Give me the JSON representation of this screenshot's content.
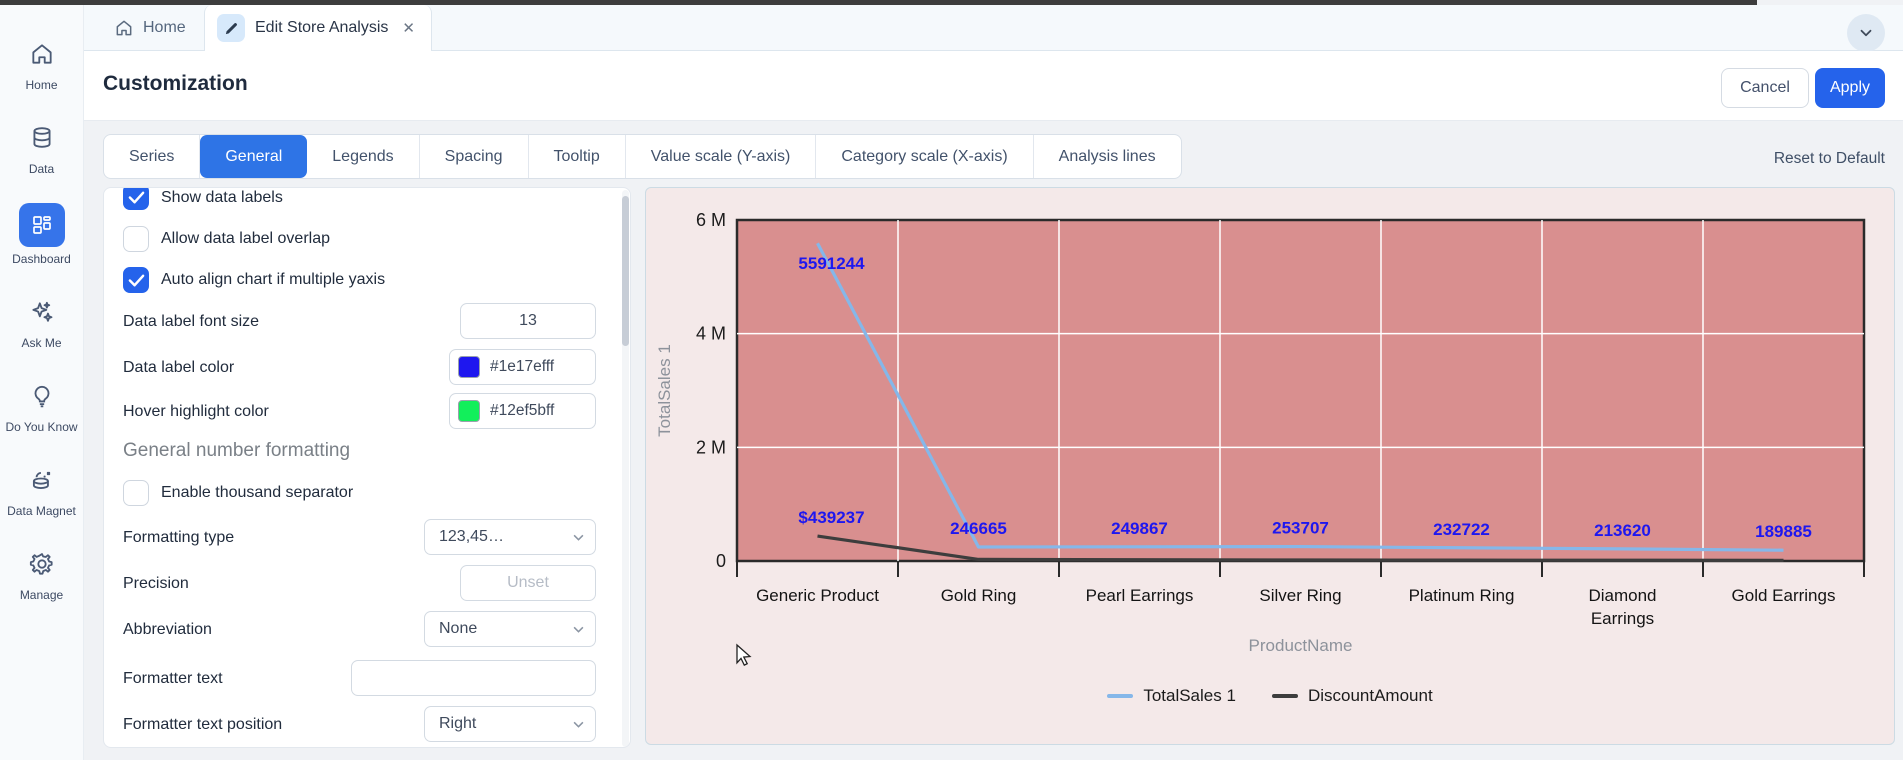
{
  "colors": {
    "accent_blue": "#2e74e6",
    "apply_blue": "#2563eb",
    "data_label_blue": "#1e17ef",
    "swatch_blue": "#1e17ef",
    "swatch_green": "#12ef5b",
    "plot_bg": "#d98f8f",
    "chart_panel_bg": "#f4e9e9",
    "series_blue": "#85b7e9",
    "series_dark": "#3d3d3d"
  },
  "doc_strip": {
    "home_label": "Home",
    "doc_tab_label": "Edit Store Analysis",
    "close_glyph": "✕"
  },
  "sidebar": {
    "items": [
      {
        "label": "Home",
        "icon": "home-icon",
        "active": false
      },
      {
        "label": "Data",
        "icon": "database-icon",
        "active": false
      },
      {
        "label": "Dashboard",
        "icon": "dashboard-icon",
        "active": true
      },
      {
        "label": "Ask Me",
        "icon": "sparkles-icon",
        "active": false
      },
      {
        "label": "Do You Know",
        "icon": "lightbulb-icon",
        "active": false
      },
      {
        "label": "Data Magnet",
        "icon": "data-magnet-icon",
        "active": false
      },
      {
        "label": "Manage",
        "icon": "gear-icon",
        "active": false
      }
    ]
  },
  "header": {
    "title": "Customization",
    "cancel_label": "Cancel",
    "apply_label": "Apply"
  },
  "tab_strip": {
    "tabs": [
      "Series",
      "General",
      "Legends",
      "Spacing",
      "Tooltip",
      "Value scale (Y-axis)",
      "Category scale (X-axis)",
      "Analysis lines"
    ],
    "active_tab": "General",
    "reset_label": "Reset to Default"
  },
  "form": {
    "show_data_labels": {
      "label": "Show data labels",
      "checked": true
    },
    "allow_overlap": {
      "label": "Allow data label overlap",
      "checked": false
    },
    "auto_align": {
      "label": "Auto align chart if multiple yaxis",
      "checked": true
    },
    "font_size": {
      "label": "Data label font size",
      "value": "13"
    },
    "label_color": {
      "label": "Data label color",
      "value": "#1e17efff",
      "swatch": "#1e17ef"
    },
    "hover_color": {
      "label": "Hover highlight color",
      "value": "#12ef5bff",
      "swatch": "#12ef5b"
    },
    "section_heading": "General number formatting",
    "thousand_separator": {
      "label": "Enable thousand separator",
      "checked": false
    },
    "formatting_type": {
      "label": "Formatting type",
      "value": "123,45…"
    },
    "precision": {
      "label": "Precision",
      "placeholder": "Unset"
    },
    "abbreviation": {
      "label": "Abbreviation",
      "value": "None"
    },
    "formatter_text": {
      "label": "Formatter text",
      "value": ""
    },
    "formatter_text_position": {
      "label": "Formatter text position",
      "value": "Right"
    }
  },
  "chart_data": {
    "type": "line",
    "xlabel": "ProductName",
    "ylabel": "TotalSales 1",
    "categories": [
      "Generic Product",
      "Gold Ring",
      "Pearl Earrings",
      "Silver Ring",
      "Platinum Ring",
      "Diamond Earrings",
      "Gold Earrings"
    ],
    "series": [
      {
        "name": "TotalSales 1",
        "color": "#85b7e9",
        "values": [
          5591244,
          246665,
          249867,
          253707,
          232722,
          213620,
          189885
        ],
        "labels": [
          "5591244",
          "246665",
          "249867",
          "253707",
          "232722",
          "213620",
          "189885"
        ]
      },
      {
        "name": "DiscountAmount",
        "color": "#3d3d3d",
        "values": [
          439237,
          28000,
          22000,
          18000,
          15000,
          13000,
          11000
        ],
        "labels": [
          "$439237",
          "",
          "",
          "",
          "",
          "",
          ""
        ]
      }
    ],
    "ylim": [
      0,
      6000000
    ],
    "yticks": [
      {
        "v": 0,
        "label": "0"
      },
      {
        "v": 2000000,
        "label": "2 M"
      },
      {
        "v": 4000000,
        "label": "4 M"
      },
      {
        "v": 6000000,
        "label": "6 M"
      }
    ],
    "grid": true,
    "legend_position": "bottom",
    "plot_bg": "#d98f8f",
    "grid_color": "#ffffff",
    "data_label_color": "#1e17ef"
  }
}
